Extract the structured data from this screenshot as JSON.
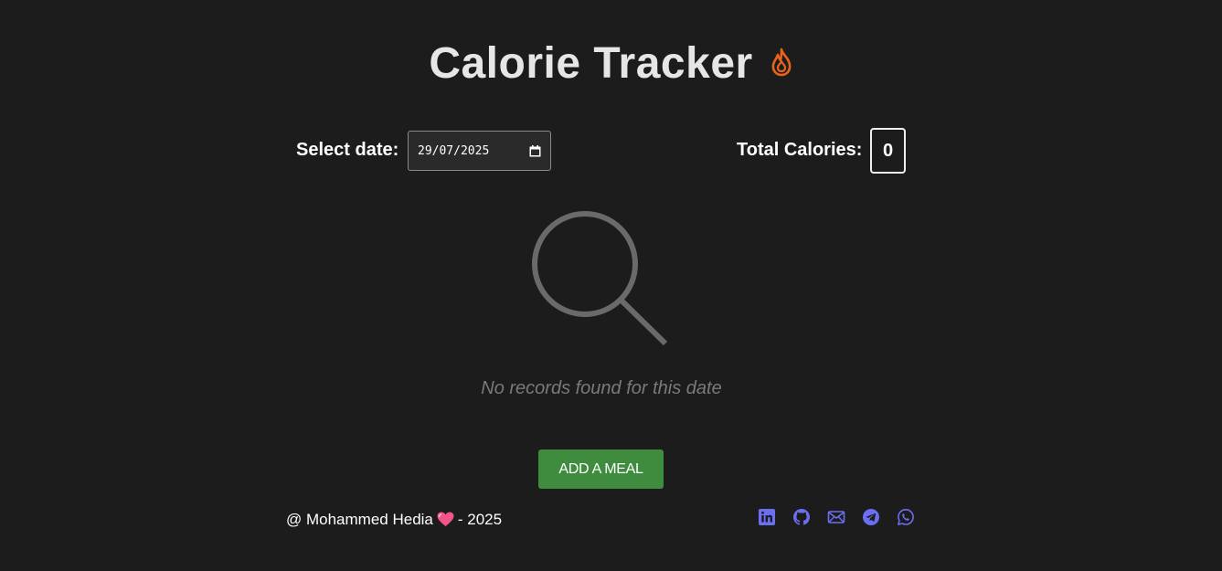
{
  "app": {
    "title": "Calorie Tracker",
    "title_icon": "flame-icon"
  },
  "date_picker": {
    "label": "Select date:",
    "value": "29/07/2025",
    "icon": "calendar-icon"
  },
  "totals": {
    "label": "Total Calories:",
    "value": "0"
  },
  "empty_state": {
    "icon": "magnifying-glass-icon",
    "message": "No records found for this date"
  },
  "actions": {
    "add_meal_label": "ADD A MEAL"
  },
  "footer": {
    "prefix": "@ Mohammed Hedia",
    "suffix": "- 2025",
    "heart_icon": "heart-icon",
    "social_links": [
      "linkedin-icon",
      "github-icon",
      "mail-icon",
      "telegram-icon",
      "whatsapp-icon"
    ]
  },
  "colors": {
    "background": "#1c1c1c",
    "accent_flame": "#e8641a",
    "button_green": "#3f8c3f",
    "social_icon": "#6b6ff0",
    "muted_text": "#7a7a7a",
    "heart": "#f2558a"
  }
}
